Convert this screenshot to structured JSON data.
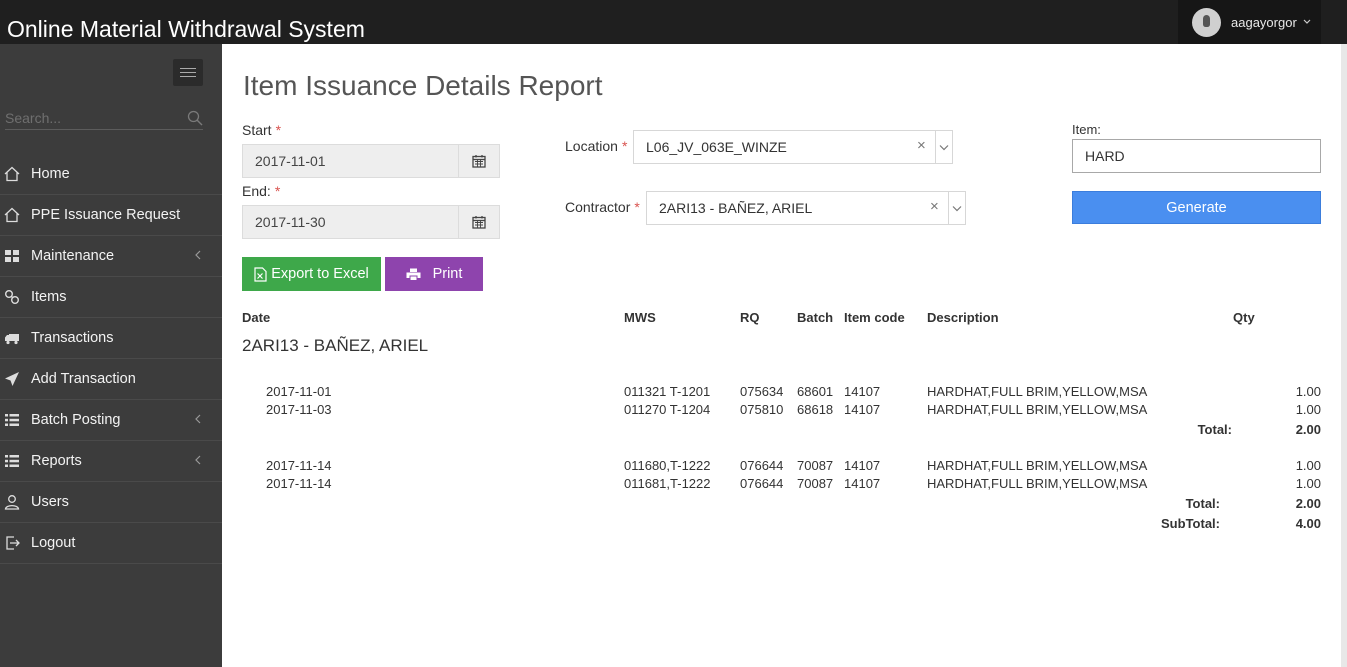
{
  "app": {
    "title": "Online Material Withdrawal System"
  },
  "user": {
    "name": "aagayorgor"
  },
  "sidebar": {
    "search_placeholder": "Search...",
    "items": [
      {
        "label": "Home",
        "icon": "home-icon",
        "has_submenu": false
      },
      {
        "label": "PPE Issuance Request",
        "icon": "home-icon",
        "has_submenu": false
      },
      {
        "label": "Maintenance",
        "icon": "grid-icon",
        "has_submenu": true
      },
      {
        "label": "Items",
        "icon": "link-icon",
        "has_submenu": false
      },
      {
        "label": "Transactions",
        "icon": "truck-icon",
        "has_submenu": false
      },
      {
        "label": "Add Transaction",
        "icon": "send-icon",
        "has_submenu": false
      },
      {
        "label": "Batch Posting",
        "icon": "list-icon",
        "has_submenu": true
      },
      {
        "label": "Reports",
        "icon": "list-icon",
        "has_submenu": true
      },
      {
        "label": "Users",
        "icon": "user-icon",
        "has_submenu": false
      },
      {
        "label": "Logout",
        "icon": "logout-icon",
        "has_submenu": false
      }
    ]
  },
  "page": {
    "title": "Item Issuance Details Report"
  },
  "filters": {
    "start_label": "Start",
    "start_value": "2017-11-01",
    "end_label": "End:",
    "end_value": "2017-11-30",
    "required_mark": "*",
    "location_label": "Location",
    "location_value": "L06_JV_063E_WINZE",
    "contractor_label": "Contractor",
    "contractor_value": "2ARI13 - BAÑEZ, ARIEL",
    "item_label": "Item:",
    "item_value": "HARD",
    "clear_glyph": "×"
  },
  "buttons": {
    "generate": "Generate",
    "export": "Export to Excel",
    "print": "Print"
  },
  "report": {
    "headers": {
      "date": "Date",
      "mws": "MWS",
      "rq": "RQ",
      "batch": "Batch",
      "item_code": "Item code",
      "description": "Description",
      "qty": "Qty"
    },
    "group_title": "2ARI13 - BAÑEZ, ARIEL",
    "rows": [
      {
        "date": "2017-11-01",
        "mws": "011321 T-1201",
        "rq": "075634",
        "batch": "68601",
        "item_code": "14107",
        "description": "HARDHAT,FULL BRIM,YELLOW,MSA",
        "qty": "1.00"
      },
      {
        "date": "2017-11-03",
        "mws": "011270 T-1204",
        "rq": "075810",
        "batch": "68618",
        "item_code": "14107",
        "description": "HARDHAT,FULL BRIM,YELLOW,MSA",
        "qty": "1.00"
      },
      {
        "date": "2017-11-14",
        "mws": "011680,T-1222",
        "rq": "076644",
        "batch": "70087",
        "item_code": "14107",
        "description": "HARDHAT,FULL BRIM,YELLOW,MSA",
        "qty": "1.00"
      },
      {
        "date": "2017-11-14",
        "mws": "011681,T-1222",
        "rq": "076644",
        "batch": "70087",
        "item_code": "14107",
        "description": "HARDHAT,FULL BRIM,YELLOW,MSA",
        "qty": "1.00"
      }
    ],
    "total_label": "Total:",
    "total_1": "2.00",
    "total_2": "2.00",
    "subtotal_label": "SubTotal:",
    "subtotal": "4.00"
  },
  "colors": {
    "topbar": "#1f1f1f",
    "sidebar": "#3c3c3c",
    "generate": "#4a8ff0",
    "export": "#3ea84a",
    "print": "#8e44ad",
    "required": "#d9534f"
  }
}
